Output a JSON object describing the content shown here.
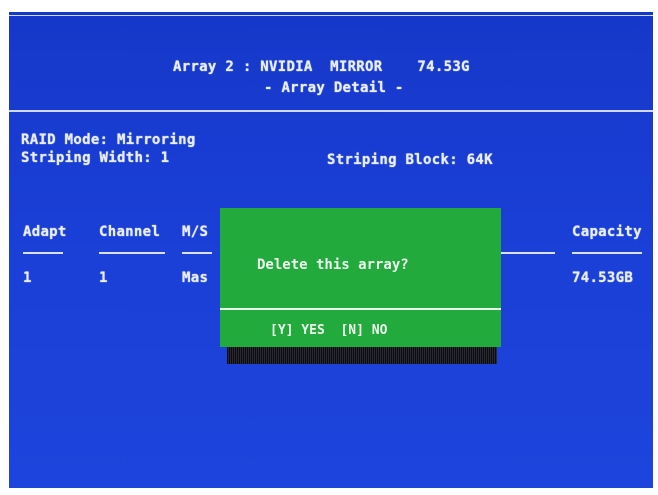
{
  "header": {
    "title": "Array 2 : NVIDIA  MIRROR    74.53G",
    "subtitle": "- Array Detail -"
  },
  "info": {
    "raid_mode": "RAID Mode: Mirroring",
    "striping_width": "Striping Width: 1",
    "striping_block": "Striping Block: 64K"
  },
  "table": {
    "headers": {
      "adapt": "Adapt",
      "channel": "Channel",
      "ms": "M/S",
      "capacity": "Capacity"
    },
    "row": {
      "adapt": "1",
      "channel": "1",
      "ms": "Mas",
      "capacity": "74.53GB"
    }
  },
  "dialog": {
    "message": "Delete this array?",
    "options": "[Y] YES  [N] NO"
  },
  "colors": {
    "screen_bg": "#1a3fd6",
    "dialog_bg": "#22ab3c",
    "text": "#e9eefc"
  }
}
